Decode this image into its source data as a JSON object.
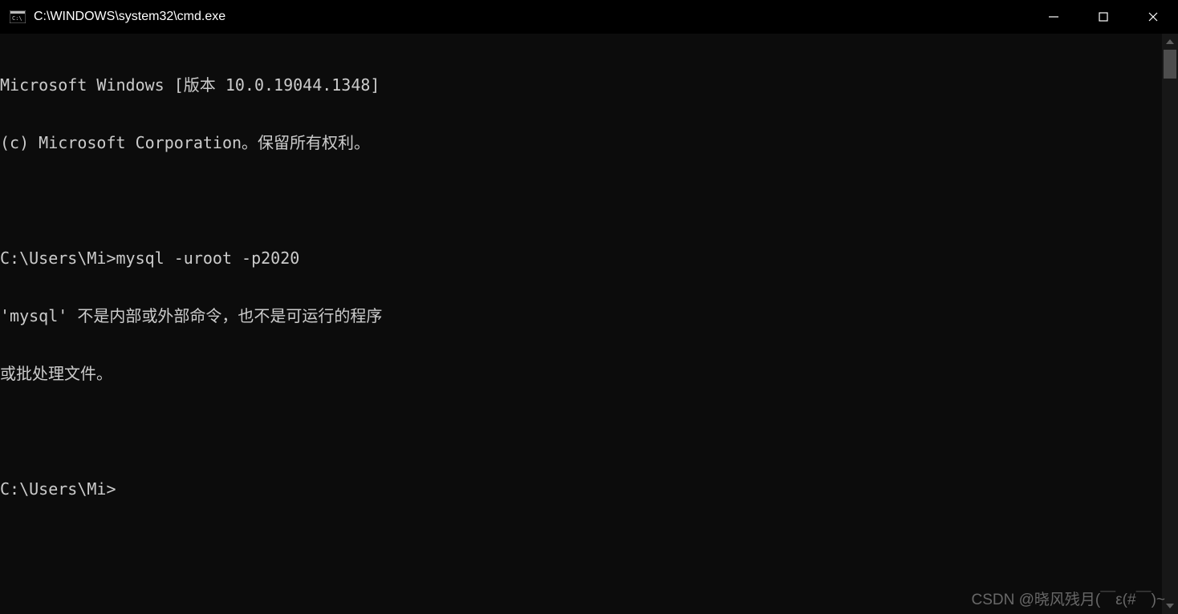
{
  "titlebar": {
    "title": "C:\\WINDOWS\\system32\\cmd.exe"
  },
  "terminal": {
    "lines": [
      "Microsoft Windows [版本 10.0.19044.1348]",
      "(c) Microsoft Corporation。保留所有权利。",
      "",
      "C:\\Users\\Mi>mysql -uroot -p2020",
      "'mysql' 不是内部或外部命令，也不是可运行的程序",
      "或批处理文件。",
      "",
      "C:\\Users\\Mi>"
    ]
  },
  "watermark": "CSDN @晓风残月(￣ε(#￣)~"
}
